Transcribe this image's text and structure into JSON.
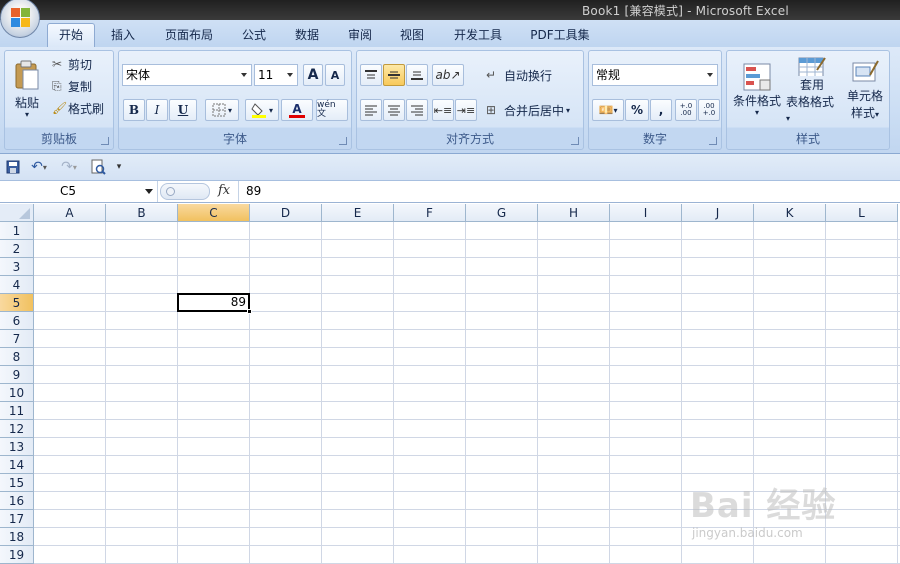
{
  "window": {
    "title": "Book1  [兼容模式] - Microsoft Excel"
  },
  "tabs": [
    {
      "label": "开始",
      "active": true
    },
    {
      "label": "插入"
    },
    {
      "label": "页面布局"
    },
    {
      "label": "公式"
    },
    {
      "label": "数据"
    },
    {
      "label": "审阅"
    },
    {
      "label": "视图"
    },
    {
      "label": "开发工具"
    },
    {
      "label": "PDF工具集"
    }
  ],
  "clipboard": {
    "paste": "粘贴",
    "cut": "剪切",
    "copy": "复制",
    "format_painter": "格式刷",
    "label": "剪贴板"
  },
  "font": {
    "name": "宋体",
    "size": "11",
    "bold": "B",
    "italic": "I",
    "underline": "U",
    "grow": "A",
    "shrink": "A",
    "font_color": "A",
    "phonetic": "wén 文",
    "label": "字体"
  },
  "alignment": {
    "wrap_text": "自动换行",
    "merge_center": "合并后居中",
    "label": "对齐方式"
  },
  "number": {
    "format": "常规",
    "percent": "%",
    "comma": ",",
    "inc_decimal": "+.0 .00",
    "dec_decimal": ".00 +.0",
    "label": "数字"
  },
  "styles": {
    "conditional": "条件格式",
    "table_format_1": "套用",
    "table_format_2": "表格格式",
    "cell_styles_1": "单元格",
    "cell_styles_2": "样式",
    "label": "样式"
  },
  "formula_bar": {
    "name_box": "C5",
    "fx": "fx",
    "value": "89"
  },
  "columns": [
    "A",
    "B",
    "C",
    "D",
    "E",
    "F",
    "G",
    "H",
    "I",
    "J",
    "K",
    "L"
  ],
  "rows": [
    "1",
    "2",
    "3",
    "4",
    "5",
    "6",
    "7",
    "8",
    "9",
    "10",
    "11",
    "12",
    "13",
    "14",
    "15",
    "16",
    "17",
    "18",
    "19"
  ],
  "active_cell": {
    "ref": "C5",
    "value": "89"
  },
  "watermark": {
    "main": "Bai 经验",
    "sub": "jingyan.baidu.com"
  },
  "colors": {
    "ribbon": "#dbe7f7",
    "selected_header": "#f5c66a",
    "grid_line": "#d0d7e5"
  }
}
